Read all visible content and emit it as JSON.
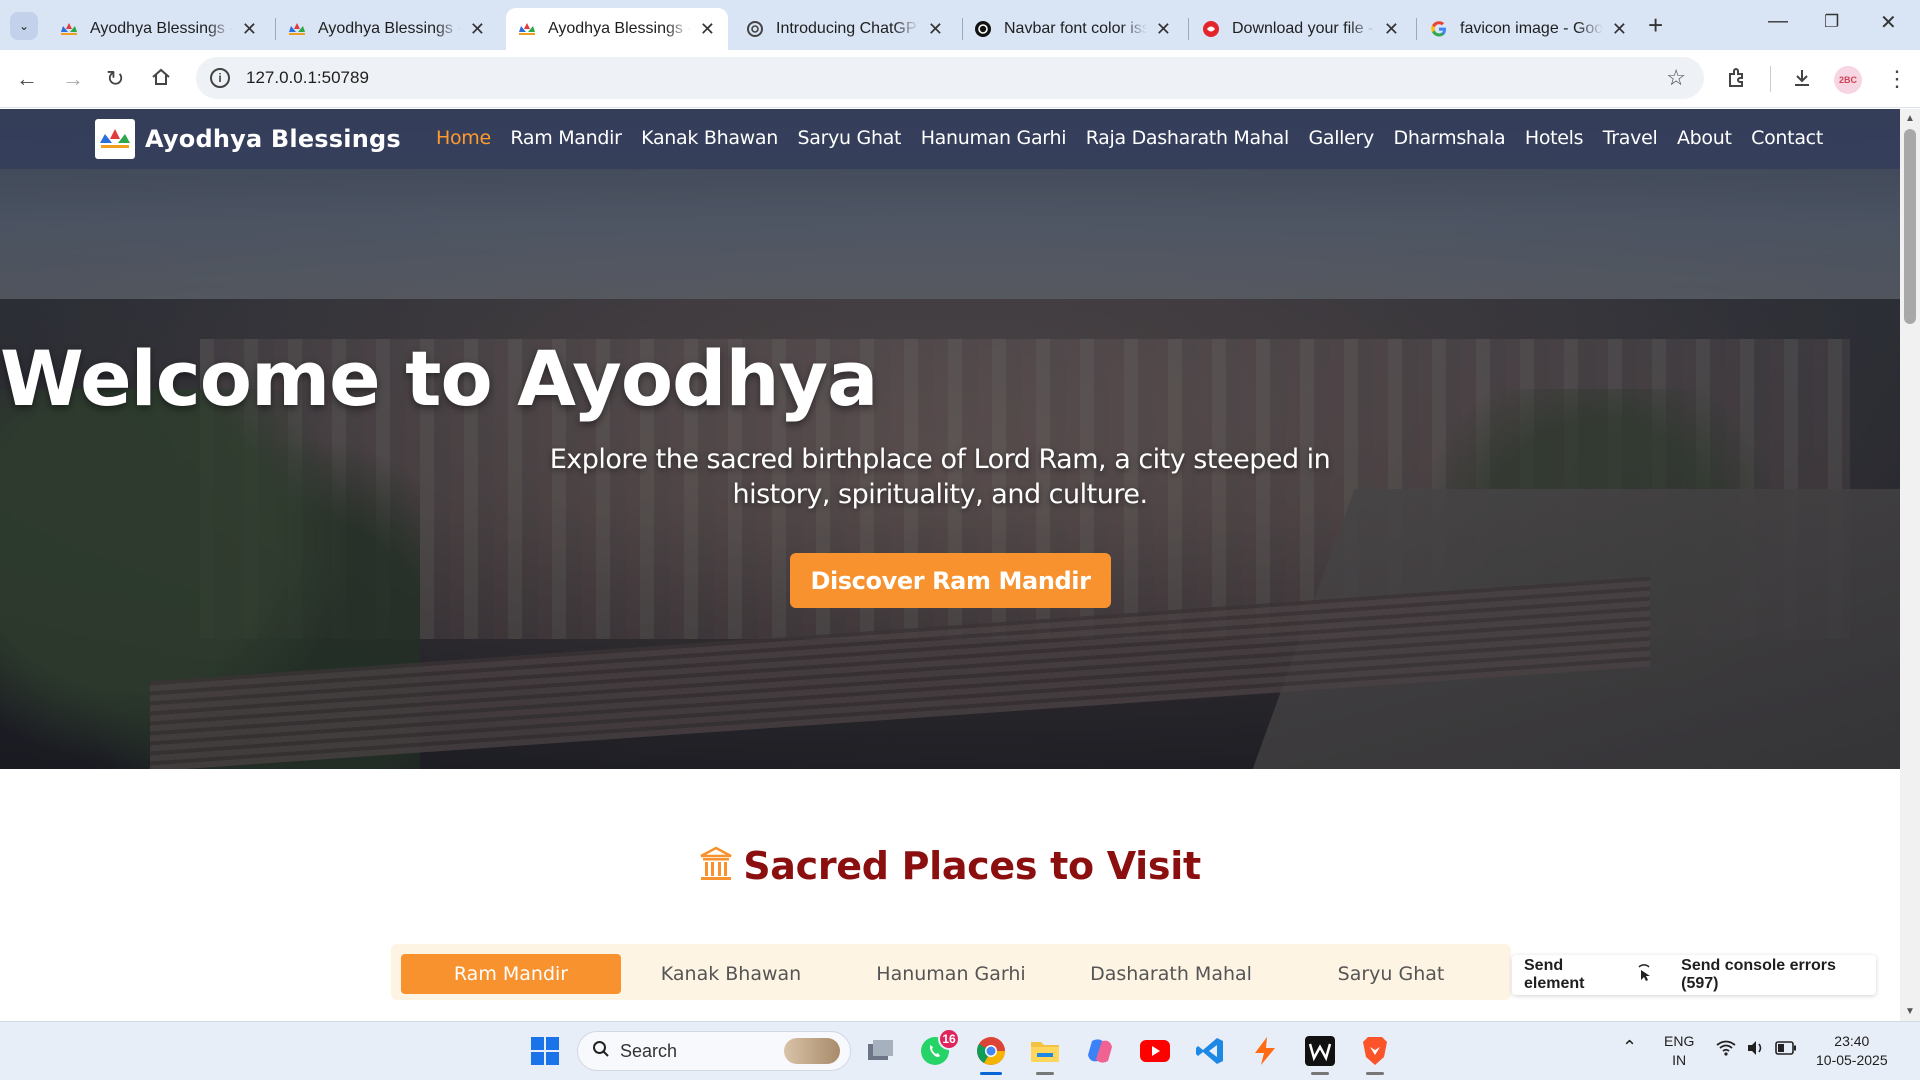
{
  "browser": {
    "tabs": [
      {
        "title": "Ayodhya Blessings - ",
        "favicon": "ayodhya-favicon"
      },
      {
        "title": "Ayodhya Blessings - ",
        "favicon": "ayodhya-favicon"
      },
      {
        "title": "Ayodhya Blessings - ",
        "favicon": "ayodhya-favicon",
        "active": true
      },
      {
        "title": "Introducing ChatGPT",
        "favicon": "openai-icon"
      },
      {
        "title": "Navbar font color iss",
        "favicon": "openai-icon"
      },
      {
        "title": "Download your file - ",
        "favicon": "pdf-download-icon"
      },
      {
        "title": "favicon image - Goo",
        "favicon": "google-icon"
      }
    ],
    "url": "127.0.0.1:50789",
    "profile_initials": "2BC"
  },
  "site": {
    "brand": "Ayodhya Blessings",
    "nav": [
      "Home",
      "Ram Mandir",
      "Kanak Bhawan",
      "Saryu Ghat",
      "Hanuman Garhi",
      "Raja Dasharath Mahal",
      "Gallery",
      "Dharmshala",
      "Hotels",
      "Travel",
      "About",
      "Contact"
    ],
    "active_nav": "Home",
    "hero": {
      "title": "Welcome to Ayodhya",
      "subtitle": "Explore the sacred birthplace of Lord Ram, a city steeped in history, spirituality, and culture.",
      "cta": "Discover Ram Mandir"
    },
    "section": {
      "title": "Sacred Places to Visit",
      "icon": "temple-icon",
      "tabs": [
        "Ram Mandir",
        "Kanak Bhawan",
        "Hanuman Garhi",
        "Dasharath Mahal",
        "Saryu Ghat"
      ],
      "active_tab": "Ram Mandir"
    },
    "colors": {
      "accent": "#f7922f",
      "title": "#8b0f0f",
      "navbar": "#343e5a"
    }
  },
  "devtools_popup": {
    "send_element": "Send element",
    "send_console_errors": "Send console errors (597)"
  },
  "taskbar": {
    "search_placeholder": "Search",
    "whatsapp_badge": "16",
    "language": "ENG",
    "region": "IN",
    "time": "23:40",
    "date": "10-05-2025"
  }
}
